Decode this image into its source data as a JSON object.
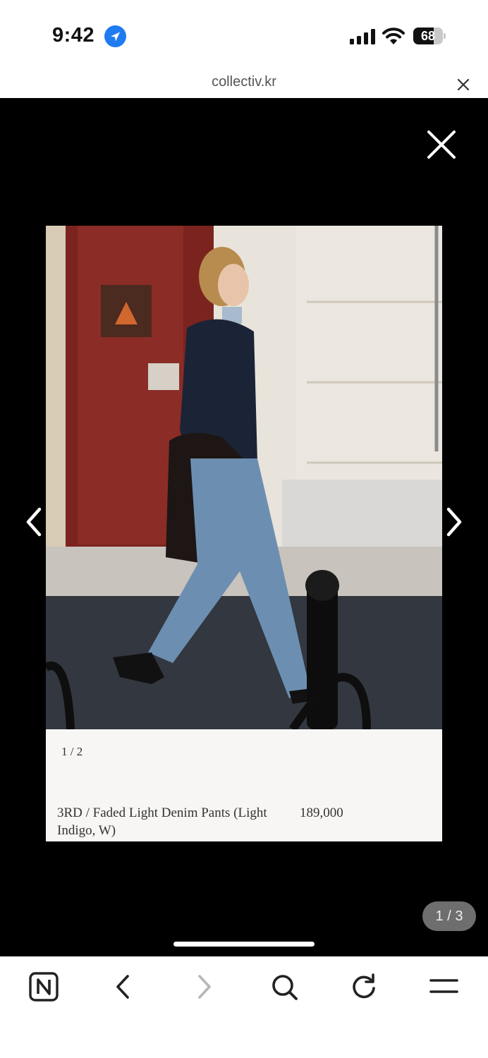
{
  "status_bar": {
    "time": "9:42",
    "battery": "68",
    "battery_level": 0.68
  },
  "browser": {
    "url": "collectiv.kr"
  },
  "viewer": {
    "counter": "1 / 3",
    "card": {
      "index": "1 / 2",
      "product_name": "3RD / Faded Light Denim Pants (Light Indigo, W)",
      "price": "189,000"
    }
  },
  "icons": {
    "location": "location-arrow-icon",
    "signal": "cellular-signal-icon",
    "wifi": "wifi-icon",
    "close": "close-icon",
    "prev": "chevron-left-icon",
    "next": "chevron-right-icon",
    "naver": "naver-n-icon",
    "back": "back-icon",
    "forward": "forward-icon",
    "search": "search-icon",
    "refresh": "refresh-icon",
    "menu": "menu-icon"
  },
  "colors": {
    "viewer_bg": "#000000",
    "location_blue": "#1f7cf0",
    "counter_bg": "#6e6e6e"
  }
}
